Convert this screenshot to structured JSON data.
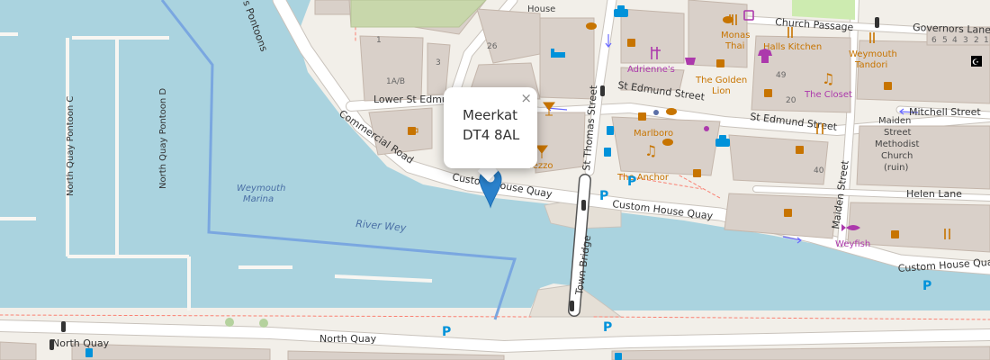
{
  "popup": {
    "line1": "Meerkat",
    "line2": "DT4 8AL",
    "close_glyph": "×"
  },
  "streets": {
    "commercial_road": "Commercial Road",
    "custom_house_quay_1": "Custom House Quay",
    "custom_house_quay_2": "Custom House Quay",
    "custom_house_quay_3": "Custom House Qua",
    "lower_st_edmund": "Lower St Edmund",
    "st_edmund_street_1": "St Edmund Street",
    "st_edmund_street_2": "St Edmund Street",
    "st_thomas_street": "St Thomas Street",
    "church_passage": "Church Passage",
    "governors_lane": "Governors Lane",
    "mitchell_street": "Mitchell Street",
    "helen_lane": "Helen Lane",
    "maiden_street": "Maiden Street",
    "town_bridge": "Town Bridge",
    "north_quay_1": "North Quay",
    "north_quay_2": "North Quay",
    "pontoons": "s Pontoons"
  },
  "water": {
    "river_wey": "River Wey",
    "marina_1": "Weymouth",
    "marina_2": "Marina",
    "pontoon_c": "North Quay Pontoon C",
    "pontoon_d": "North Quay Pontoon D"
  },
  "pois": {
    "house": "House",
    "monas_1": "Monas",
    "monas_2": "Thai",
    "halls_kitchen": "Halls Kitchen",
    "adriennes": "Adrienne's",
    "golden_lion_1": "The Golden",
    "golden_lion_2": "Lion",
    "weymouth_tandori_1": "Weymouth",
    "weymouth_tandori_2": "Tandori",
    "the_closet": "The Closet",
    "marlboro": "Marlboro",
    "prezzo": "Prezzo",
    "the_anchor": "The Anchor",
    "methodist_1": "Maiden",
    "methodist_2": "Street",
    "methodist_3": "Methodist",
    "methodist_4": "Church",
    "methodist_5": "(ruin)",
    "weyfish": "Weyfish"
  },
  "house_numbers": {
    "n26": "26",
    "n1": "1",
    "n1ab": "1A/B",
    "n3": "3",
    "n49": "49",
    "n20": "20",
    "n40": "40",
    "n6": "6",
    "n5": "5",
    "n4": "4",
    "n3b": "3",
    "n2": "2",
    "n1b": "1"
  },
  "icons": [
    "map-marker-icon",
    "cafe-icon",
    "restaurant-icon",
    "fast-food-icon",
    "bar-icon",
    "pub-icon",
    "parking-icon",
    "bicycle-parking-icon",
    "taxi-icon",
    "bus-stop-icon",
    "music-icon",
    "clothes-icon",
    "shop-icon",
    "hotel-icon",
    "fish-icon",
    "place-of-worship-icon",
    "traffic-signals-icon"
  ],
  "colors": {
    "water": "#aad3df",
    "land": "#f2efe9",
    "building": "#d9d0c9",
    "building_stroke": "#c4b6ab",
    "road": "#ffffff",
    "road_casing": "#c9c3bc",
    "marker": "#2a81cb",
    "food_icon": "#c77400",
    "shop_icon": "#ac39ac",
    "transport_icon": "#0092da"
  }
}
